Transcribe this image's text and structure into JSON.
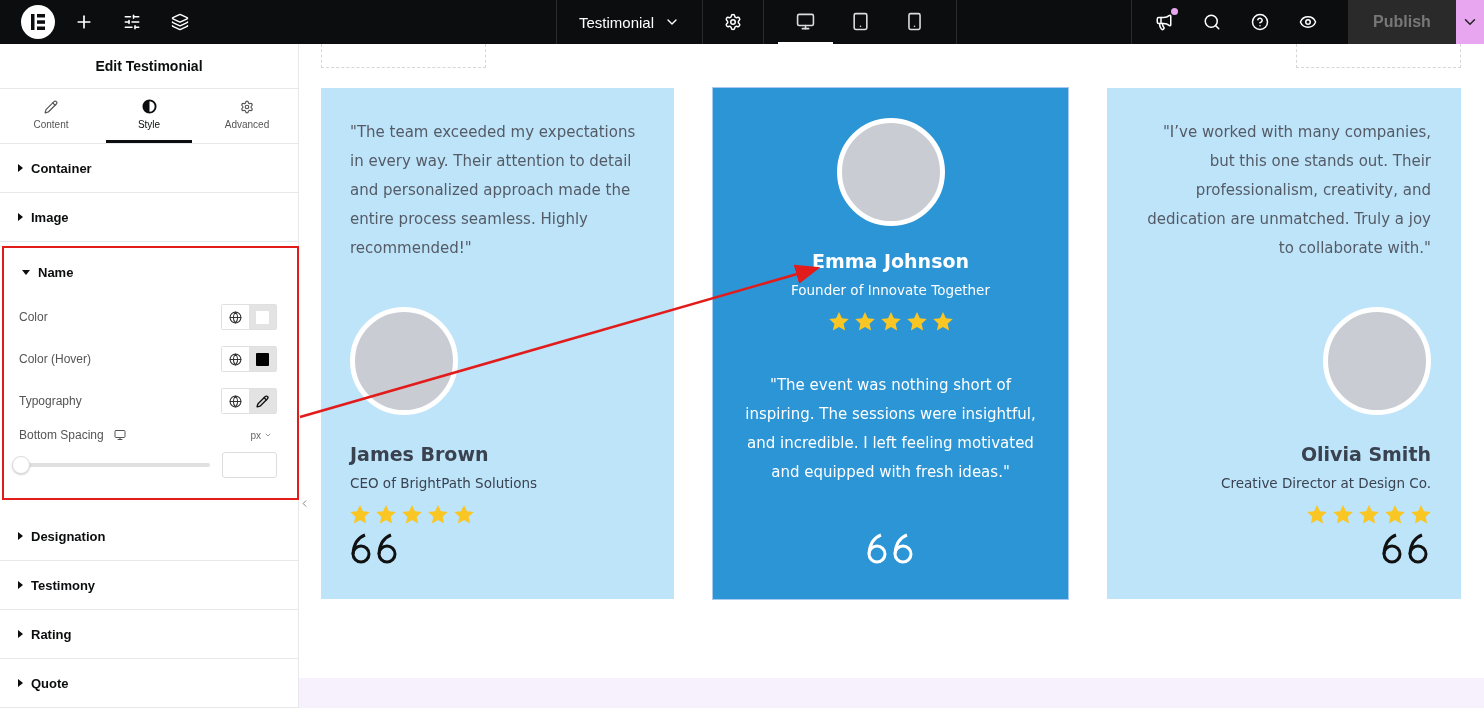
{
  "top_bar": {
    "document_title": "Testimonial",
    "devices": [
      {
        "kind": "desktop",
        "selected": true
      },
      {
        "kind": "tablet",
        "selected": false
      },
      {
        "kind": "mobile",
        "selected": false
      }
    ],
    "publish": {
      "label": "Publish",
      "disabled": true
    }
  },
  "panel": {
    "title": "Edit Testimonial",
    "tabs": [
      {
        "kind": "content",
        "label": "Content",
        "selected": false
      },
      {
        "kind": "style",
        "label": "Style",
        "selected": true
      },
      {
        "kind": "advanced",
        "label": "Advanced",
        "selected": false
      }
    ],
    "sections": [
      {
        "label": "Container",
        "expanded": false
      },
      {
        "label": "Image",
        "expanded": false
      },
      {
        "label": "Name",
        "expanded": true,
        "highlighted": true,
        "controls": [
          {
            "kind": "color",
            "label": "Color",
            "color": "#ffffff"
          },
          {
            "kind": "color",
            "label": "Color (Hover)",
            "color": "#000000"
          },
          {
            "kind": "typography",
            "label": "Typography"
          },
          {
            "kind": "slider",
            "label": "Bottom Spacing",
            "unit": "px",
            "level": 0
          }
        ]
      },
      {
        "label": "Designation",
        "expanded": false
      },
      {
        "label": "Testimony",
        "expanded": false
      },
      {
        "label": "Rating",
        "expanded": false
      },
      {
        "label": "Quote",
        "expanded": false
      }
    ]
  },
  "testimonials": [
    {
      "kind": "left",
      "selected": false,
      "quote": "\"The team exceeded my expectations in every way. Their attention to detail and personalized approach made the entire process seamless. Highly recommended!\"",
      "name": "James Brown",
      "role": "CEO of BrightPath Solutions",
      "stars": 5
    },
    {
      "kind": "center",
      "selected": true,
      "quote": "\"The event was nothing short of inspiring. The sessions were insightful, and incredible. I left feeling motivated and equipped with fresh ideas.\"",
      "name": "Emma Johnson",
      "role": "Founder of Innovate Together",
      "stars": 5
    },
    {
      "kind": "right",
      "selected": false,
      "quote": "\"I’ve worked with many companies, but this one stands out. Their professionalism, creativity, and dedication are unmatched. Truly a joy to collaborate with.\"",
      "name": "Olivia Smith",
      "role": "Creative Director at Design Co.",
      "stars": 5
    }
  ]
}
